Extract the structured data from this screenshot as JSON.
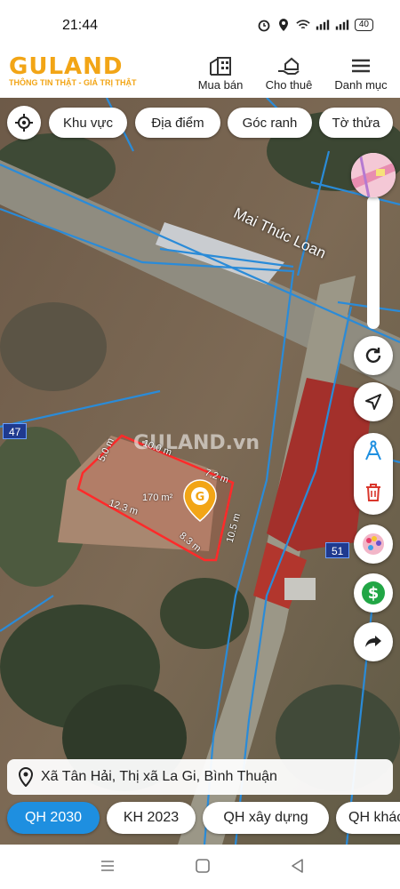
{
  "status": {
    "time": "21:44",
    "battery": "40"
  },
  "header": {
    "logo_text": "GULAND",
    "tagline": "THÔNG TIN THẬT - GIÁ TRỊ THẬT",
    "nav": [
      {
        "label": "Mua bán",
        "icon": "building-icon"
      },
      {
        "label": "Cho thuê",
        "icon": "hand-house-icon"
      },
      {
        "label": "Danh mục",
        "icon": "menu-icon"
      }
    ]
  },
  "filters": [
    "Khu vực",
    "Địa điểm",
    "Góc ranh",
    "Tờ thửa"
  ],
  "map": {
    "road_name": "Mai Thúc Loan",
    "watermark": "GULAND.vn",
    "parcel_tags": [
      "47",
      "51"
    ],
    "parcel": {
      "area": "170 m²",
      "dimensions": [
        "5.0 m",
        "10.0 m",
        "7.2 m",
        "12.3 m",
        "10.5 m",
        "8.3 m"
      ]
    }
  },
  "address": "Xã Tân Hải, Thị xã La Gi, Bình Thuận",
  "tabs": [
    "QH 2030",
    "KH 2023",
    "QH xây dựng",
    "QH khác"
  ],
  "colors": {
    "accent": "#1e8fe0",
    "brand": "#f2a516",
    "parcel_outline": "#ff2a2a",
    "boundary": "#2a8bd8"
  }
}
